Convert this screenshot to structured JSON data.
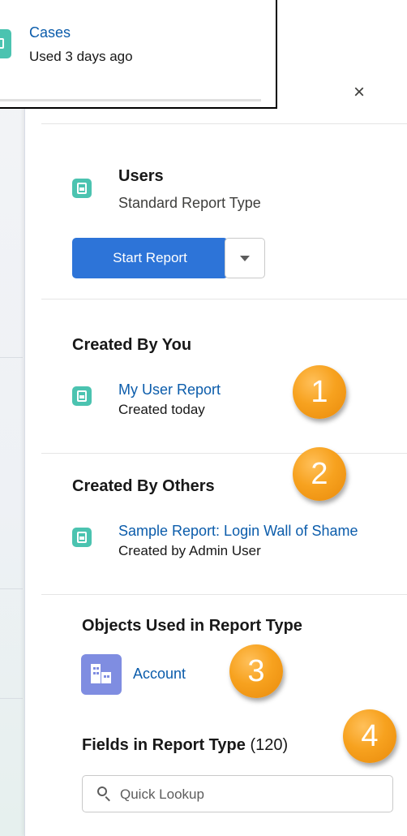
{
  "popover": {
    "item_link": "Cases",
    "item_meta": "Used 3 days ago"
  },
  "panel": {
    "close_glyph": "×",
    "report_type": {
      "name": "Users",
      "subtitle": "Standard Report Type",
      "start_button": "Start Report"
    },
    "created_by_you": {
      "heading": "Created By You",
      "item_link": "My User Report",
      "item_meta": "Created today"
    },
    "created_by_others": {
      "heading": "Created By Others",
      "item_link": "Sample Report: Login Wall of Shame",
      "item_meta": "Created by Admin User"
    },
    "objects": {
      "heading": "Objects Used in Report Type",
      "item_link": "Account"
    },
    "fields": {
      "heading": "Fields in Report Type",
      "count": "(120)",
      "search_placeholder": "Quick Lookup"
    }
  },
  "callouts": [
    "1",
    "2",
    "3",
    "4"
  ],
  "colors": {
    "report_icon": "#4bc3b0",
    "object_icon": "#7f8de1",
    "primary_button": "#2d74d8",
    "link": "#0b5cab",
    "callout": "#f7a21f"
  },
  "icons": {
    "report": "report-icon",
    "object": "account-object-icon",
    "close": "close-icon",
    "dropdown": "chevron-down-icon",
    "search": "search-icon"
  }
}
